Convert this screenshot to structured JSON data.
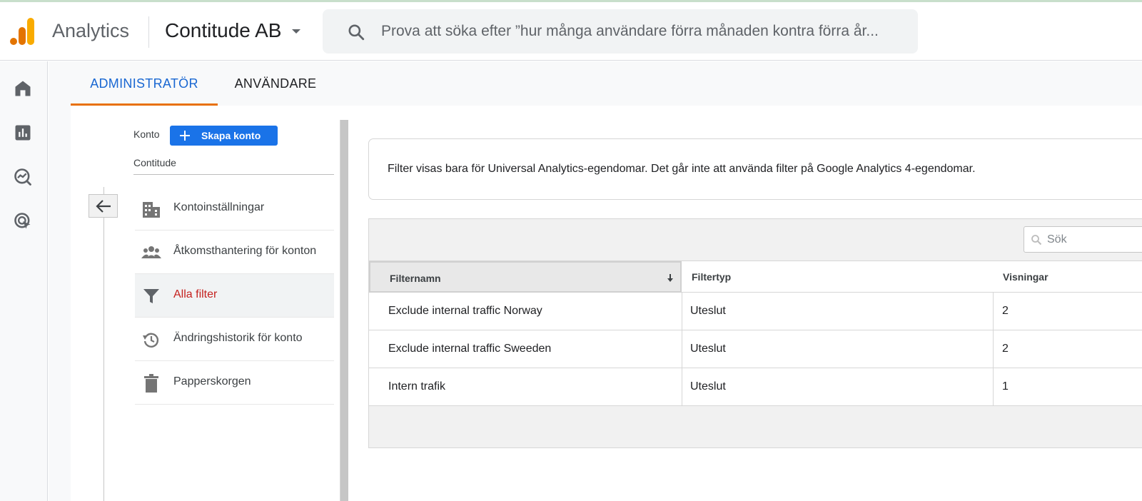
{
  "header": {
    "app_name": "Analytics",
    "account_name": "Contitude AB",
    "search_placeholder": "Prova att söka efter ”hur många användare förra månaden kontra förra år..."
  },
  "left_nav": {
    "icons": [
      "home-icon",
      "reports-icon",
      "explore-icon",
      "advertising-icon"
    ]
  },
  "tabs": [
    {
      "label": "ADMINISTRATÖR",
      "active": true
    },
    {
      "label": "ANVÄNDARE",
      "active": false
    }
  ],
  "account_column": {
    "konto_label": "Konto",
    "create_button": "Skapa konto",
    "account_name": "Contitude",
    "menu": [
      {
        "label": "Kontoinställningar",
        "icon": "building-icon",
        "active": false
      },
      {
        "label": "Åtkomsthantering för konton",
        "icon": "people-icon",
        "active": false
      },
      {
        "label": "Alla filter",
        "icon": "filter-icon",
        "active": true
      },
      {
        "label": "Ändringshistorik för konto",
        "icon": "history-icon",
        "active": false
      },
      {
        "label": "Papperskorgen",
        "icon": "trash-icon",
        "active": false
      }
    ]
  },
  "info_message": "Filter visas bara för Universal Analytics-egendomar. Det går inte att använda filter på Google Analytics 4-egendomar.",
  "table": {
    "search_placeholder": "Sök",
    "columns": [
      "Filternamn",
      "Filtertyp",
      "Visningar"
    ],
    "rows": [
      [
        "Exclude internal traffic Norway",
        "Uteslut",
        "2"
      ],
      [
        "Exclude internal traffic Sweeden",
        "Uteslut",
        "2"
      ],
      [
        "Intern trafik",
        "Uteslut",
        "1"
      ]
    ]
  },
  "colors": {
    "accent_blue": "#1a73e8",
    "tab_active": "#1967d2",
    "tab_underline": "#e8710a",
    "active_menu_text": "#c5221f",
    "logo_orange": "#f9ab00",
    "logo_dark_orange": "#e37400"
  }
}
